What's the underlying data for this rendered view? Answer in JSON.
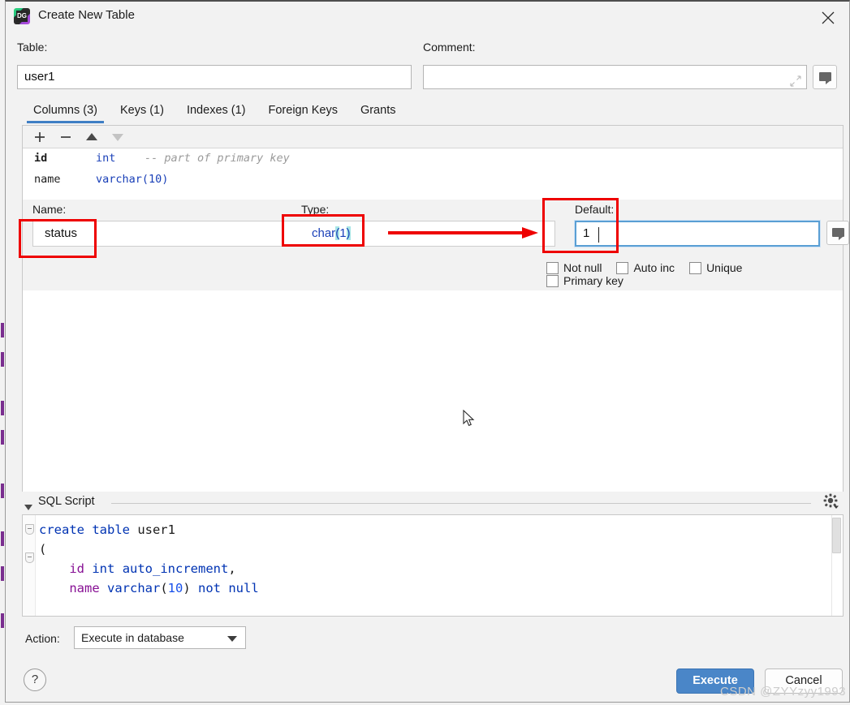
{
  "window": {
    "title": "Create New Table",
    "app_icon": "datagrip-icon",
    "close_icon": "close-icon"
  },
  "header": {
    "table_label": "Table:",
    "table_value": "user1",
    "comment_label": "Comment:",
    "comment_value": "",
    "comment_expand_icon": "expand-icon",
    "comment_button_icon": "comment-bubble-icon"
  },
  "tabs": [
    {
      "label": "Columns (3)",
      "active": true
    },
    {
      "label": "Keys (1)",
      "active": false
    },
    {
      "label": "Indexes (1)",
      "active": false
    },
    {
      "label": "Foreign Keys",
      "active": false
    },
    {
      "label": "Grants",
      "active": false
    }
  ],
  "toolbar": {
    "add_icon": "plus-icon",
    "remove_icon": "minus-icon",
    "move_up_icon": "arrow-up-icon",
    "move_down_icon": "arrow-down-icon"
  },
  "columns": [
    {
      "name": "id",
      "type": "int",
      "comment": "-- part of primary key",
      "bold": true
    },
    {
      "name": "name",
      "type": "varchar(10)",
      "comment": "",
      "bold": false
    }
  ],
  "editor": {
    "name_label": "Name:",
    "name_value": "status",
    "type_label": "Type:",
    "type_value": "char(1)",
    "type_kw": "char",
    "type_open": "(",
    "type_arg": "1",
    "type_close": ")",
    "default_label": "Default:",
    "default_value": "1",
    "default_button_icon": "comment-bubble-icon",
    "checkboxes": [
      {
        "label": "Not null",
        "checked": false
      },
      {
        "label": "Auto inc",
        "checked": false
      },
      {
        "label": "Unique",
        "checked": false
      },
      {
        "label": "Primary key",
        "checked": false
      }
    ]
  },
  "sql": {
    "section_title": "SQL Script",
    "collapse_icon": "chevron-down-icon",
    "settings_icon": "gear-icon",
    "lines": [
      {
        "kw": "create table",
        "rest": " user1",
        "indent": 0,
        "fold": true
      },
      {
        "kw": "",
        "rest": "(",
        "indent": 0,
        "fold": true
      },
      {
        "kw": "",
        "rest": "    id int auto_increment,",
        "indent": 1,
        "fold": false
      },
      {
        "kw": "",
        "rest": "    name varchar(10) not null",
        "indent": 1,
        "fold": false
      }
    ]
  },
  "footer": {
    "action_label": "Action:",
    "action_value": "Execute in database",
    "action_caret_icon": "chevron-down-icon",
    "help_label": "?",
    "execute_label": "Execute",
    "cancel_label": "Cancel"
  },
  "watermark": "CSDN @ZYYzyy1993",
  "colors": {
    "accent": "#3e7ec4",
    "primary_button": "#4a86c8",
    "annotation_red": "#ee0000",
    "sql_keyword": "#0033b3",
    "sql_identifier": "#871094",
    "type_blue": "#1a40b8",
    "highlight_cyan": "#a8e6e6"
  }
}
